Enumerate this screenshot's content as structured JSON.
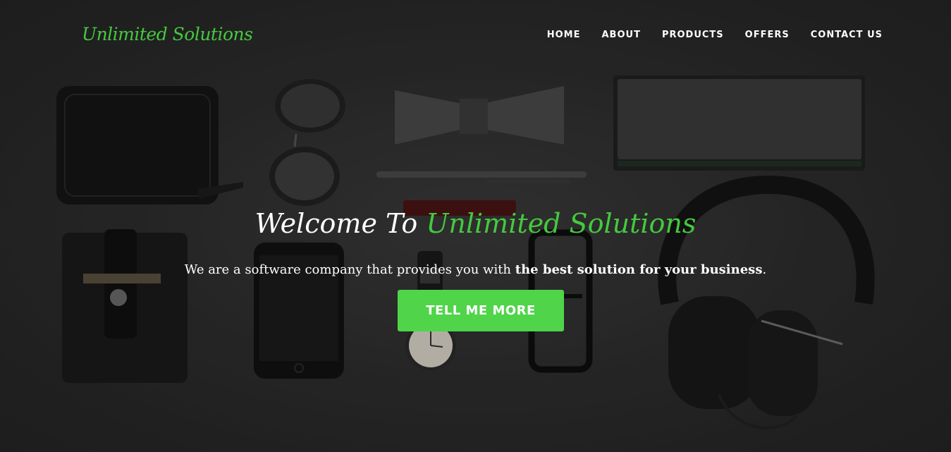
{
  "brand": {
    "name": "Unlimited Solutions"
  },
  "nav": {
    "items": [
      {
        "label": "HOME"
      },
      {
        "label": "ABOUT"
      },
      {
        "label": "PRODUCTS"
      },
      {
        "label": "OFFERS"
      },
      {
        "label": "CONTACT US"
      }
    ]
  },
  "hero": {
    "headline_prefix": "Welcome To ",
    "headline_accent": "Unlimited Solutions",
    "subtitle_prefix": "We are a software company that provides you with ",
    "subtitle_bold": "the best solution for your business",
    "subtitle_suffix": ".",
    "cta_label": "TELL ME MORE"
  },
  "colors": {
    "accent": "#45c93f",
    "button": "#4fd44a",
    "background": "#2e2e2e",
    "text": "#ffffff"
  }
}
